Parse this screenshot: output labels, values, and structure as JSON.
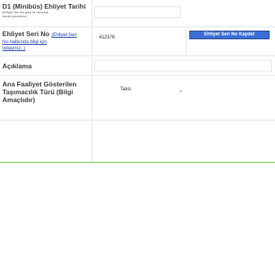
{
  "fields": {
    "d1_license_date": {
      "label": "D1 (Minibüs) Ehliyet Tarihi",
      "note": "(Ehliyet Seri No girişi ile otomatik olarak doldurulur)"
    },
    "license_serial": {
      "label": "Ehliyet Seri No",
      "label_link": "(Ehliyet Seri",
      "link_line1": "No hakkında bilgi için",
      "link_line2": "tıklayınız..)",
      "value": "412376",
      "button": "Ehliyet Seri No Kaydet"
    },
    "description": {
      "label": "Açıklama",
      "value": ""
    },
    "activity": {
      "label_line1": "Ana Faaliyet Gösterilen",
      "label_line2": "Taşımacılık Türü (Bilgi",
      "label_line3": "Amaçlıdır)",
      "selected": "Taksi",
      "chevron_icon": "chevron-down-icon"
    }
  },
  "colors": {
    "button": "#3b6fd6",
    "link": "#1a3fb0",
    "divider": "#7fc93a"
  }
}
